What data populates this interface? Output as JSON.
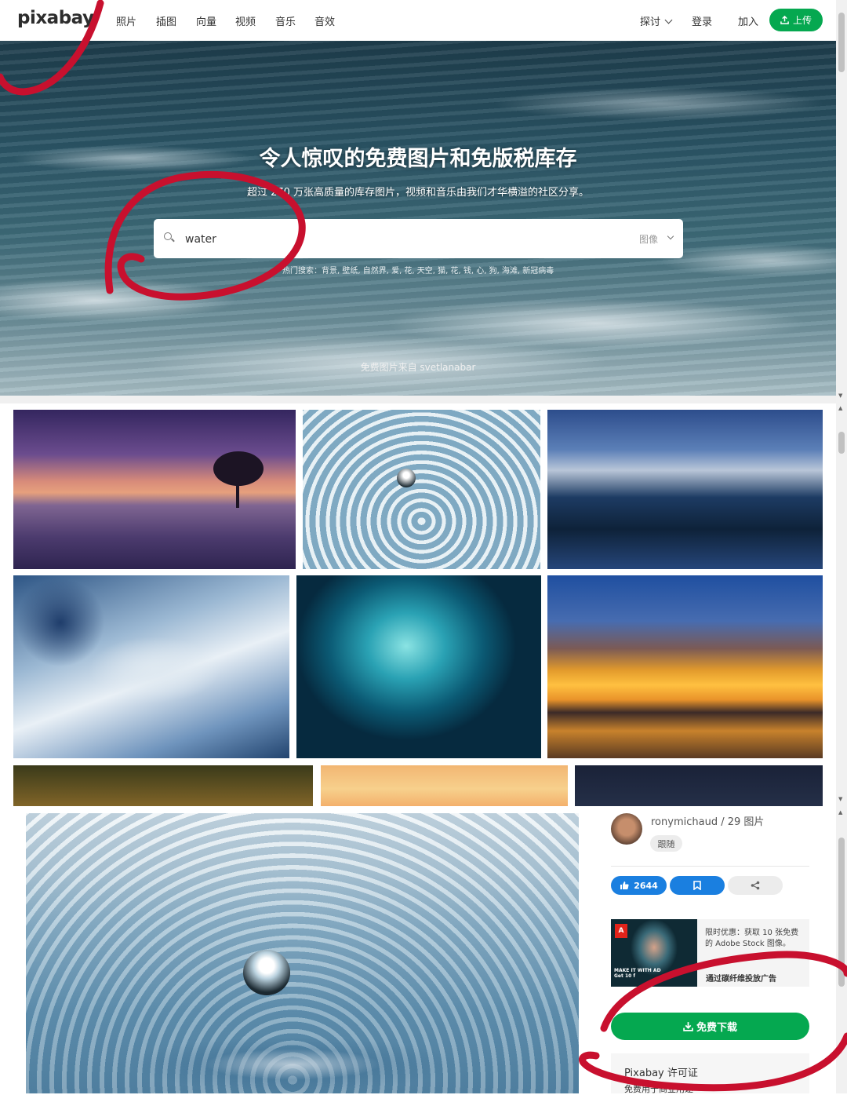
{
  "header": {
    "logo": "pixabay",
    "nav": [
      "照片",
      "插图",
      "向量",
      "视频",
      "音乐",
      "音效"
    ],
    "explore": "探讨",
    "login": "登录",
    "join": "加入",
    "upload": "上传"
  },
  "hero": {
    "title": "令人惊叹的免费图片和免版税库存",
    "subtitle": "超过 270 万张高质量的库存图片，视频和音乐由我们才华横溢的社区分享。",
    "search": {
      "value": "water",
      "type": "图像"
    },
    "hot": "热门搜索：背景, 壁纸, 自然界, 爱, 花, 天空, 猫, 花, 钱, 心, 狗, 海滩, 新冠病毒",
    "credit": "免费图片来自 svetlanabar"
  },
  "detail": {
    "user": "ronymichaud / 29 图片",
    "follow": "跟随",
    "likes": "2644",
    "ad_text": "限时优惠：获取 10 张免费的 Adobe Stock 图像。",
    "ad_make": "MAKE IT WITH AD",
    "ad_get": "Get 10 f",
    "ad_via": "通过碳纤维投放广告",
    "download": "免费下载",
    "license": "Pixabay 许可证",
    "license_note": "免费用于商业用途"
  },
  "icons": [
    "search-icon",
    "chevron-down-icon",
    "upload-icon",
    "thumbs-up-icon",
    "bookmark-icon",
    "share-icon",
    "download-icon",
    "adobe-logo"
  ],
  "colors": {
    "accent": "#05a850",
    "like": "#1a7fe0",
    "annotation": "#c8102e"
  }
}
